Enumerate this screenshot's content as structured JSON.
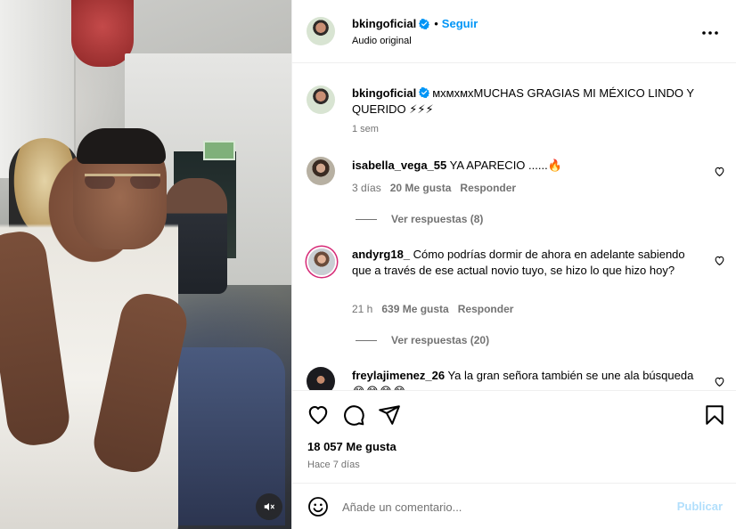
{
  "post": {
    "username": "bkingoficial",
    "follow_label": "Seguir",
    "audio": "Audio original",
    "caption": "ᴍхᴍхᴍхMUCHAS GRAGIAS MI MÉXICO LINDO Y QUERIDO ⚡⚡⚡",
    "caption_time": "1 sem",
    "likes": "18 057 Me gusta",
    "posted_ago": "Hace 7 días"
  },
  "comments": [
    {
      "username": "isabella_vega_55",
      "text": "YA APARECIO ......🔥",
      "time": "3 días",
      "likes": "20 Me gusta",
      "reply_label": "Responder",
      "view_replies": "Ver respuestas (8)"
    },
    {
      "username": "andyrg18_",
      "text": "Cómo podrías dormir de ahora en adelante sabiendo que a través de ese actual novio tuyo, se hizo lo que hizo hoy?",
      "time": "21 h",
      "likes": "639 Me gusta",
      "reply_label": "Responder",
      "view_replies": "Ver respuestas (20)"
    },
    {
      "username": "freylajimenez_26",
      "text": "Ya la gran señora también se une ala búsqueda 😂😂😂😂"
    }
  ],
  "composer": {
    "placeholder": "Añade un comentario...",
    "publish_label": "Publicar"
  },
  "icons": [
    "mute-icon",
    "more-options-icon",
    "verified-icon",
    "heart-icon",
    "comment-icon",
    "share-icon",
    "bookmark-icon",
    "emoji-icon"
  ],
  "colors": {
    "link_blue": "#0095f6",
    "publish_disabled": "#b2dffc",
    "muted_text": "#737373",
    "verified": "#0095f6"
  }
}
